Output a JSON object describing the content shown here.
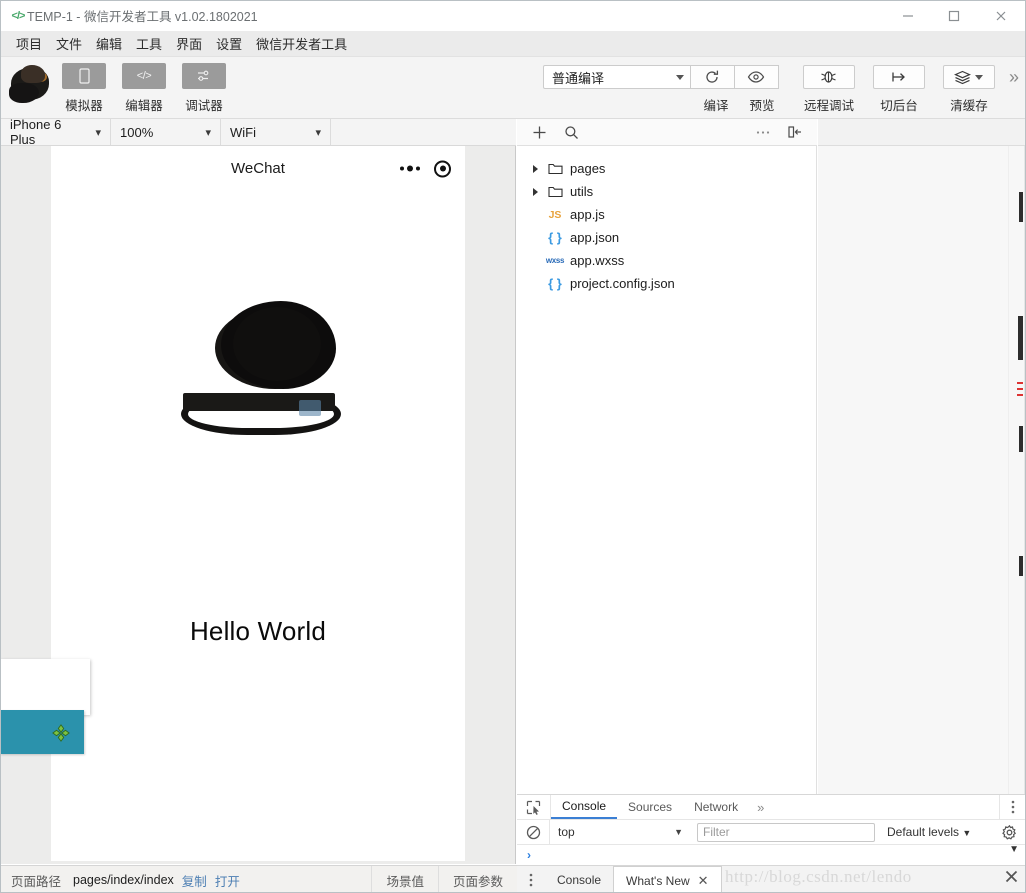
{
  "window": {
    "logo_icon": "code-brackets-icon",
    "title": "TEMP-1 - 微信开发者工具 v1.02.1802021",
    "minimize_icon": "minimize-icon",
    "maximize_icon": "maximize-icon",
    "close_icon": "close-icon"
  },
  "menubar": {
    "items": [
      {
        "label": "项目"
      },
      {
        "label": "文件"
      },
      {
        "label": "编辑"
      },
      {
        "label": "工具"
      },
      {
        "label": "界面"
      },
      {
        "label": "设置"
      },
      {
        "label": "微信开发者工具"
      }
    ]
  },
  "toolbar": {
    "avatar_icon": "user-avatar-censored",
    "left_buttons": [
      {
        "label": "模拟器",
        "icon": "phone-icon"
      },
      {
        "label": "编辑器",
        "icon": "code-icon"
      },
      {
        "label": "调试器",
        "icon": "debug-sliders-icon"
      }
    ],
    "compile_mode": {
      "value": "普通编译",
      "caret_icon": "caret-down-icon"
    },
    "compile": {
      "label": "编译",
      "icon": "refresh-icon"
    },
    "preview": {
      "label": "预览",
      "icon": "eye-icon"
    },
    "remote_debug": {
      "label": "远程调试",
      "icon": "bug-icon"
    },
    "background": {
      "label": "切后台",
      "icon": "arrow-to-right-icon"
    },
    "clear_cache": {
      "label": "清缓存",
      "icon": "layers-icon",
      "caret_icon": "caret-down-icon"
    },
    "overflow_icon": "chevron-double-right-icon"
  },
  "simulator_toolbar": {
    "device": "iPhone 6 Plus",
    "zoom": "100%",
    "network": "WiFi",
    "caret_icon": "chevron-down-icon"
  },
  "simulator": {
    "nav_title": "WeChat",
    "more_icon": "three-dots-icon",
    "target_icon": "target-circle-icon",
    "page_image": "censored-avatar-image",
    "hello_text": "Hello World",
    "overlay_card": "white-tooltip-card",
    "overlay_box_color": "#2b92ac",
    "cursor_icon": "crosshair-cursor-icon"
  },
  "explorer": {
    "add_icon": "plus-icon",
    "search_icon": "search-icon",
    "more_icon": "ellipsis-icon",
    "collapse_icon": "collapse-panel-icon",
    "tree": [
      {
        "name": "pages",
        "type": "folder",
        "icon": "folder-icon",
        "expander": "caret-right-icon",
        "depth": 0
      },
      {
        "name": "utils",
        "type": "folder",
        "icon": "folder-icon",
        "expander": "caret-right-icon",
        "depth": 0
      },
      {
        "name": "app.js",
        "type": "js",
        "icon": "js-file-icon",
        "depth": 0
      },
      {
        "name": "app.json",
        "type": "json",
        "icon": "json-file-icon",
        "depth": 0
      },
      {
        "name": "app.wxss",
        "type": "wxss",
        "icon": "wxss-file-icon",
        "depth": 0
      },
      {
        "name": "project.config.json",
        "type": "json",
        "icon": "json-file-icon",
        "depth": 0
      }
    ]
  },
  "devtools": {
    "inspect_icon": "inspect-element-icon",
    "tabs": [
      {
        "label": "Console",
        "active": true
      },
      {
        "label": "Sources",
        "active": false
      },
      {
        "label": "Network",
        "active": false
      }
    ],
    "overflow_icon": "chevron-double-right-icon",
    "kebab_icon": "kebab-menu-icon",
    "clear_icon": "clear-console-icon",
    "context": "top",
    "context_caret_icon": "caret-down-icon",
    "filter_placeholder": "Filter",
    "filter_value": "",
    "levels": "Default levels",
    "levels_caret_icon": "caret-down-icon",
    "settings_icon": "gear-icon",
    "prompt": "›",
    "scroll_caret_icon": "caret-down-icon"
  },
  "drawer": {
    "kebab_icon": "kebab-menu-icon",
    "tabs": [
      {
        "label": "Console",
        "active": false,
        "closable": false
      },
      {
        "label": "What's New",
        "active": true,
        "closable": true,
        "close_icon": "close-icon"
      }
    ],
    "watermark": "http://blog.csdn.net/lendo",
    "close_icon": "close-icon"
  },
  "statusbar": {
    "path_label": "页面路径",
    "path_value": "pages/index/index",
    "copy_label": "复制",
    "open_label": "打开",
    "scene_button": "场景值",
    "params_button": "页面参数"
  }
}
